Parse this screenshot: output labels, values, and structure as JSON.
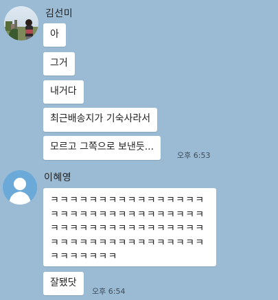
{
  "chat": {
    "groups": [
      {
        "sender": "김선미",
        "avatar_icon": "profile-photo-icon",
        "messages": [
          {
            "text": "아"
          },
          {
            "text": "그거"
          },
          {
            "text": "내거다"
          },
          {
            "text": "최근배송지가 기숙사라서"
          },
          {
            "text": "모르고 그쪽으로 보낸듯..."
          }
        ],
        "time": "오후 6:53"
      },
      {
        "sender": "이혜영",
        "avatar_icon": "default-person-icon",
        "messages": [
          {
            "text": "ㅋㅋㅋㅋㅋㅋㅋㅋㅋㅋㅋㅋㅋㅋㅋㅋㅋㅋㅋㅋㅋㅋㅋㅋㅋㅋㅋㅋㅋㅋㅋㅋㅋㅋㅋㅋㅋㅋㅋㅋㅋㅋㅋㅋㅋㅋㅋㅋㅋㅋㅋㅋㅋㅋㅋㅋㅋㅋㅋㅋㅋㅋㅋㅋㅋㅋㅋㅋㅋㅋㅋ"
          },
          {
            "text": "잘됐닷"
          }
        ],
        "time": "오후 6:54"
      }
    ]
  },
  "colors": {
    "background": "#9bbbd4",
    "bubble": "#ffffff",
    "default_avatar": "#6aa9d8"
  }
}
